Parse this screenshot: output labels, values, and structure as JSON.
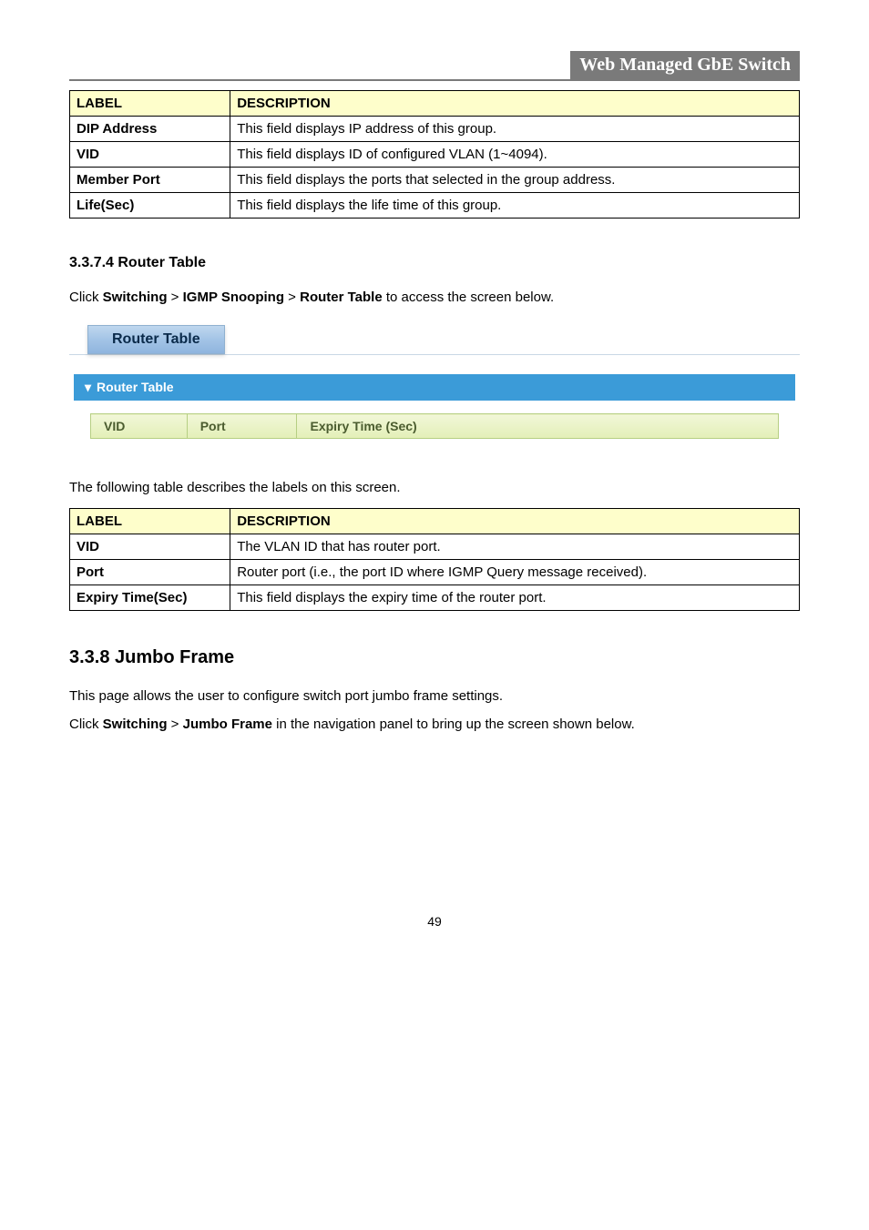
{
  "header": {
    "title": "Web Managed GbE Switch"
  },
  "table1": {
    "head": {
      "label": "LABEL",
      "desc": "DESCRIPTION"
    },
    "rows": [
      {
        "label": "DIP Address",
        "desc": "This field displays IP address of this group."
      },
      {
        "label": "VID",
        "desc": "This field displays ID of configured VLAN (1~4094)."
      },
      {
        "label": "Member Port",
        "desc": "This field displays the ports that selected in the group address."
      },
      {
        "label": "Life(Sec)",
        "desc": "This field displays the life time of this group."
      }
    ]
  },
  "section3374": {
    "heading": "3.3.7.4 Router Table",
    "text_prefix": "Click ",
    "switching": "Switching",
    "gt1": " > ",
    "igmp": "IGMP Snooping",
    "gt2": " > ",
    "router": "Router Table",
    "text_suffix": " to access the screen below."
  },
  "routerTab": {
    "label": "Router Table"
  },
  "routerPanel": {
    "header": "Router Table",
    "cols": {
      "vid": "VID",
      "port": "Port",
      "expiry": "Expiry Time (Sec)"
    }
  },
  "describeText": "The following table describes the labels on this screen.",
  "table2": {
    "head": {
      "label": "LABEL",
      "desc": "DESCRIPTION"
    },
    "rows": [
      {
        "label": "VID",
        "desc": "The VLAN ID that has router port."
      },
      {
        "label": "Port",
        "desc": "Router port (i.e., the port ID where IGMP Query message received)."
      },
      {
        "label": "Expiry Time(Sec)",
        "desc": "This field displays the expiry time of the router port."
      }
    ]
  },
  "section338": {
    "heading": "3.3.8 Jumbo Frame",
    "p1": "This page allows the user to configure switch port jumbo frame settings.",
    "p2_prefix": "Click ",
    "switching": "Switching",
    "gt": " > ",
    "jumbo": "Jumbo Frame",
    "p2_suffix": " in the navigation panel to bring up the screen shown below."
  },
  "footer": {
    "page": "49"
  }
}
